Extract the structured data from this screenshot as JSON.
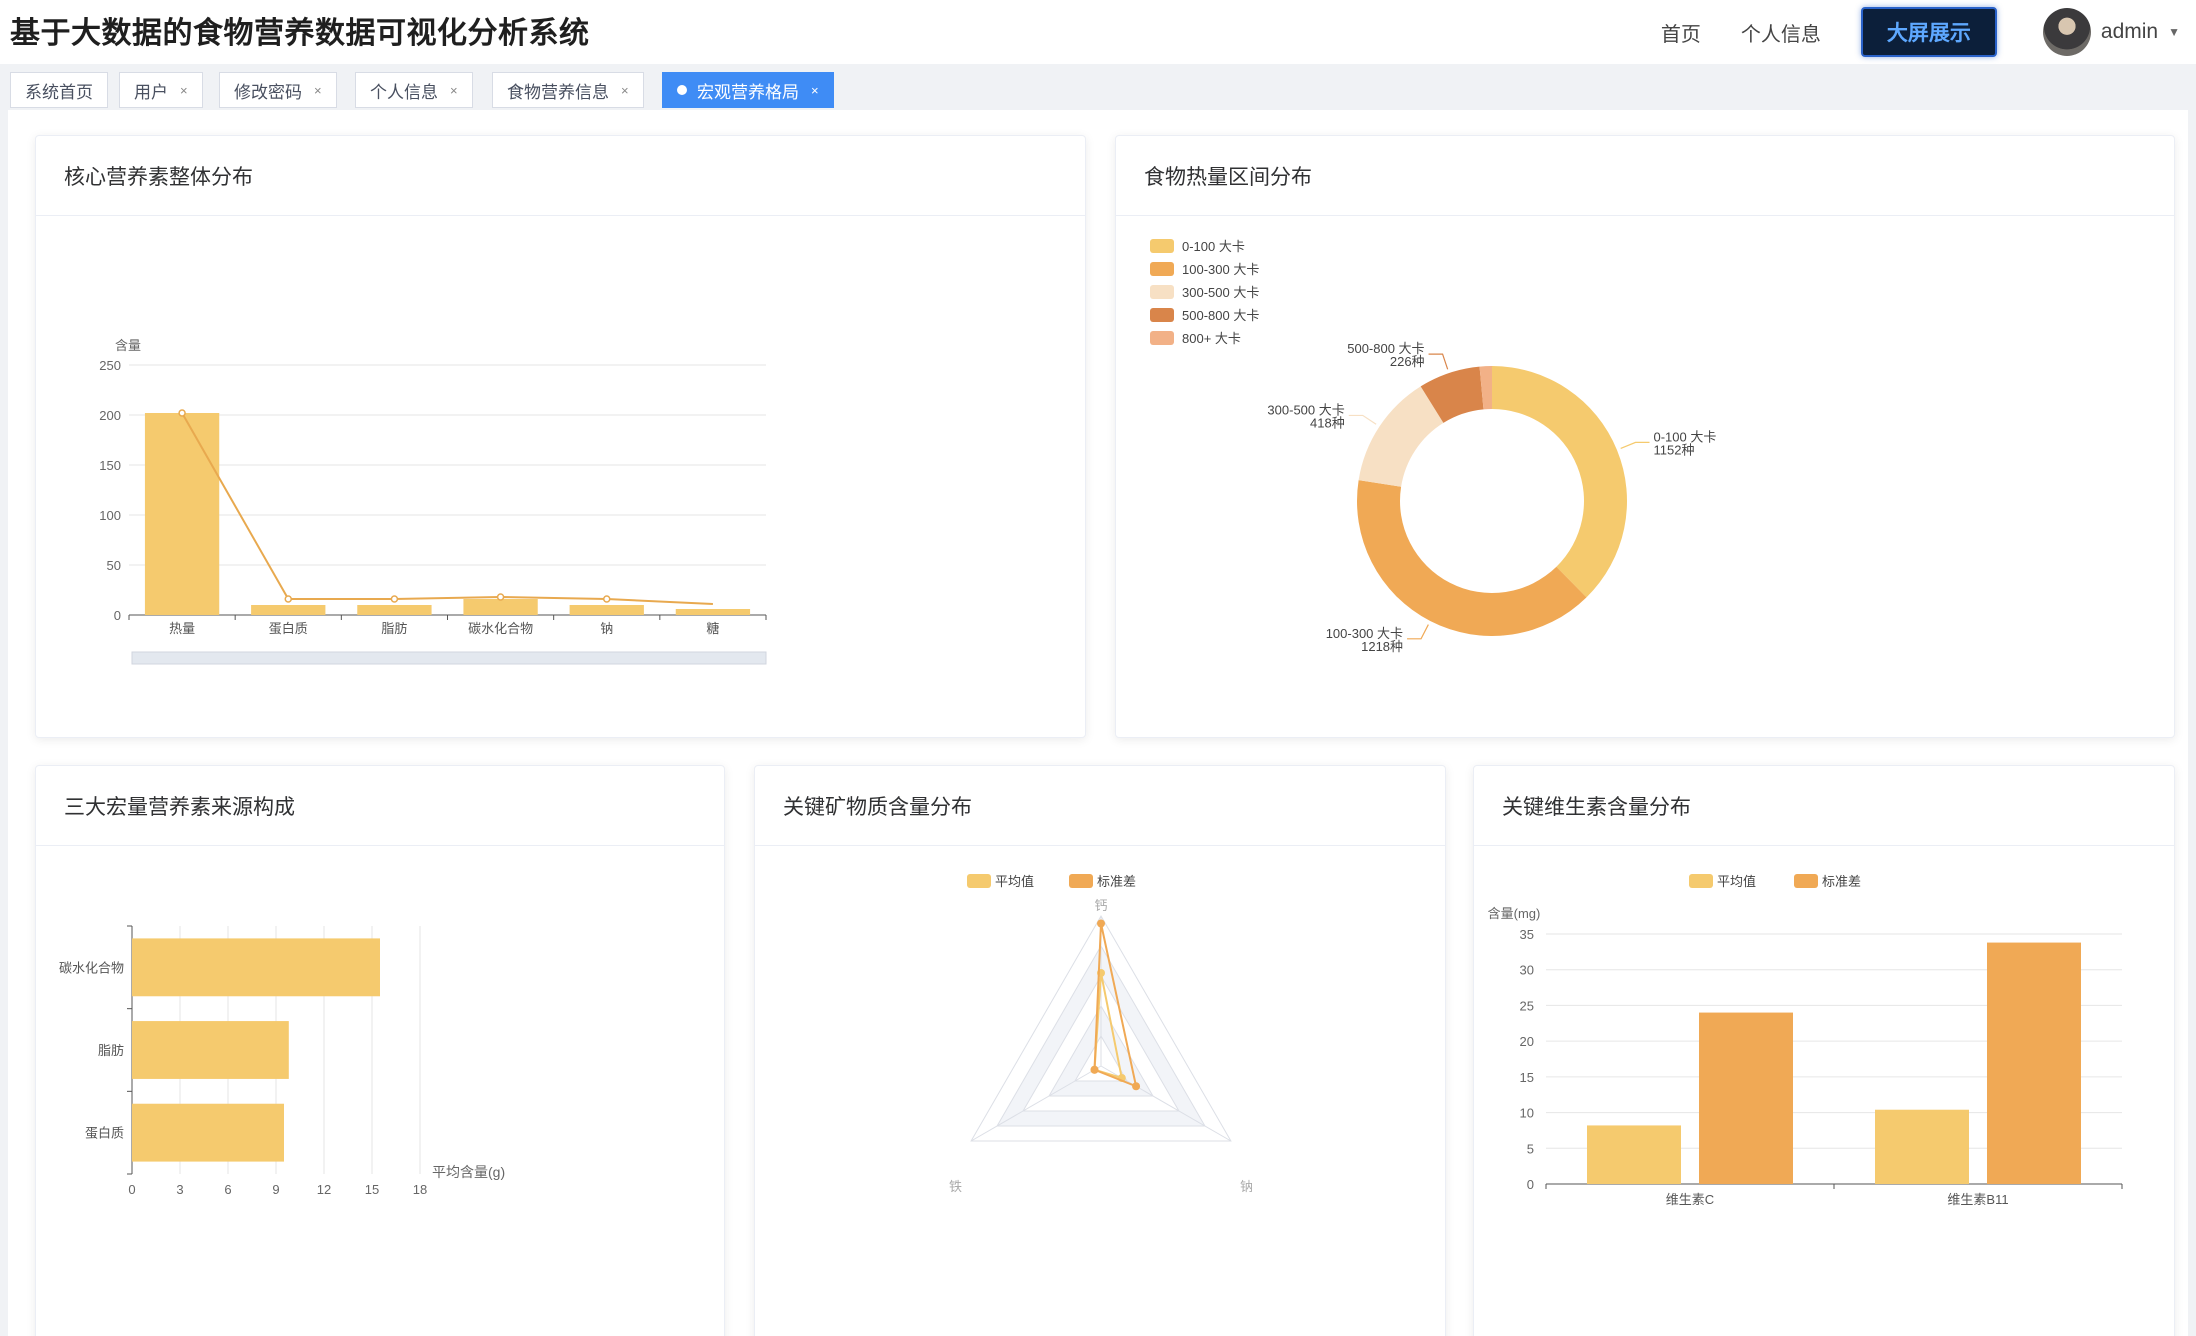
{
  "header": {
    "title": "基于大数据的食物营养数据可视化分析系统",
    "nav": {
      "home": "首页",
      "profile": "个人信息",
      "big_screen": "大屏展示"
    },
    "user": {
      "name": "admin",
      "caret": "▼"
    }
  },
  "tabs": [
    {
      "label": "系统首页",
      "closable": false
    },
    {
      "label": "用户",
      "closable": true
    },
    {
      "label": "修改密码",
      "closable": true
    },
    {
      "label": "个人信息",
      "closable": true
    },
    {
      "label": "食物营养信息",
      "closable": true
    },
    {
      "label": "宏观营养格局",
      "closable": true,
      "active": true
    }
  ],
  "tab_close_glyph": "×",
  "colors": {
    "c1": "#f5ca6e",
    "c2": "#f0a955",
    "c3": "#f7e0c4",
    "c4": "#d9854a",
    "c5": "#f2b187",
    "line": "#e8a94f",
    "accent": "#3f8cf5"
  },
  "cards": {
    "core": {
      "title": "核心营养素整体分布"
    },
    "calorie": {
      "title": "食物热量区间分布"
    },
    "macro": {
      "title": "三大宏量营养素来源构成"
    },
    "mineral": {
      "title": "关键矿物质含量分布"
    },
    "vitamin": {
      "title": "关键维生素含量分布"
    }
  },
  "chart_data": [
    {
      "id": "core",
      "type": "bar",
      "categories": [
        "热量",
        "蛋白质",
        "脂肪",
        "碳水化合物",
        "钠",
        "糖"
      ],
      "values": [
        202,
        10,
        10,
        16,
        10,
        6
      ],
      "line_values": [
        202,
        16,
        16,
        18,
        16,
        11
      ],
      "ylabel": "含量",
      "ylim": [
        0,
        250
      ],
      "yticks": [
        0,
        50,
        100,
        150,
        200,
        250
      ],
      "grid": true
    },
    {
      "id": "calorie",
      "type": "pie",
      "legend": "left-top",
      "slices": [
        {
          "name": "0-100 大卡",
          "value": 1152,
          "label": "1152种"
        },
        {
          "name": "100-300 大卡",
          "value": 1218,
          "label": "1218种"
        },
        {
          "name": "300-500 大卡",
          "value": 418,
          "label": "418种"
        },
        {
          "name": "500-800 大卡",
          "value": 226,
          "label": "226种"
        },
        {
          "name": "800+ 大卡",
          "value": 45,
          "label": ""
        }
      ]
    },
    {
      "id": "macro",
      "type": "bar",
      "orientation": "horizontal",
      "categories": [
        "碳水化合物",
        "脂肪",
        "蛋白质"
      ],
      "values": [
        15.5,
        9.8,
        9.5
      ],
      "xlabel": "平均含量(g)",
      "xlim": [
        0,
        18
      ],
      "xticks": [
        0,
        3,
        6,
        9,
        12,
        15,
        18
      ]
    },
    {
      "id": "mineral",
      "type": "radar",
      "indicators": [
        "钙",
        "钠",
        "铁"
      ],
      "legend": "top",
      "series": [
        {
          "name": "平均值",
          "values": [
            0.62,
            0.16,
            0.05
          ]
        },
        {
          "name": "标准差",
          "values": [
            0.95,
            0.27,
            0.05
          ]
        }
      ]
    },
    {
      "id": "vitamin",
      "type": "bar",
      "categories": [
        "维生素C",
        "维生素B11"
      ],
      "legend": "top",
      "series": [
        {
          "name": "平均值",
          "values": [
            8.2,
            10.4
          ]
        },
        {
          "name": "标准差",
          "values": [
            24.0,
            33.8
          ]
        }
      ],
      "ylabel": "含量(mg)",
      "ylim": [
        0,
        35
      ],
      "yticks": [
        0,
        5,
        10,
        15,
        20,
        25,
        30,
        35
      ],
      "grid": true
    }
  ]
}
